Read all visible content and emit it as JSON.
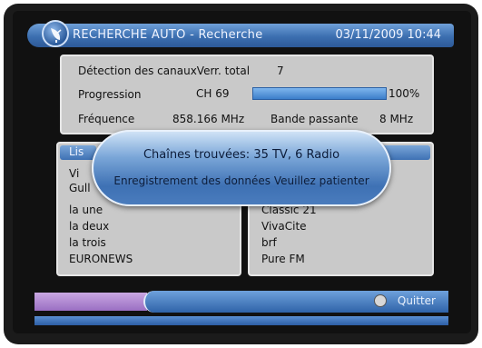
{
  "title": "RECHERCHE AUTO - Recherche",
  "datetime": "03/11/2009 10:44",
  "info": {
    "detect_label": "Détection des canauxVerr. total",
    "detect_value": "7",
    "progress_label": "Progression",
    "progress_channel": "CH 69",
    "progress_percent": "100%",
    "progress_fraction": 1.0,
    "freq_label": "Fréquence",
    "freq_value": "858.166 MHz",
    "bw_label": "Bande passante",
    "bw_value": "8 MHz"
  },
  "tv_list_header": "Lis",
  "tv_list": [
    "Vi",
    "Gull",
    "la une",
    "la deux",
    "la trois",
    "EURONEWS"
  ],
  "radio_list": [
    "Classic 21",
    "VivaCite",
    "brf",
    "Pure FM"
  ],
  "popup": {
    "line1": "Chaînes trouvées: 35 TV,  6 Radio",
    "line2": "Enregistrement des données   Veuillez patienter"
  },
  "footer": {
    "quit_label": "Quitter"
  },
  "colors": {
    "accent_blue": "#3c6fb0",
    "panel_gray": "#c9c9c9",
    "purple": "#9a6fc3"
  }
}
